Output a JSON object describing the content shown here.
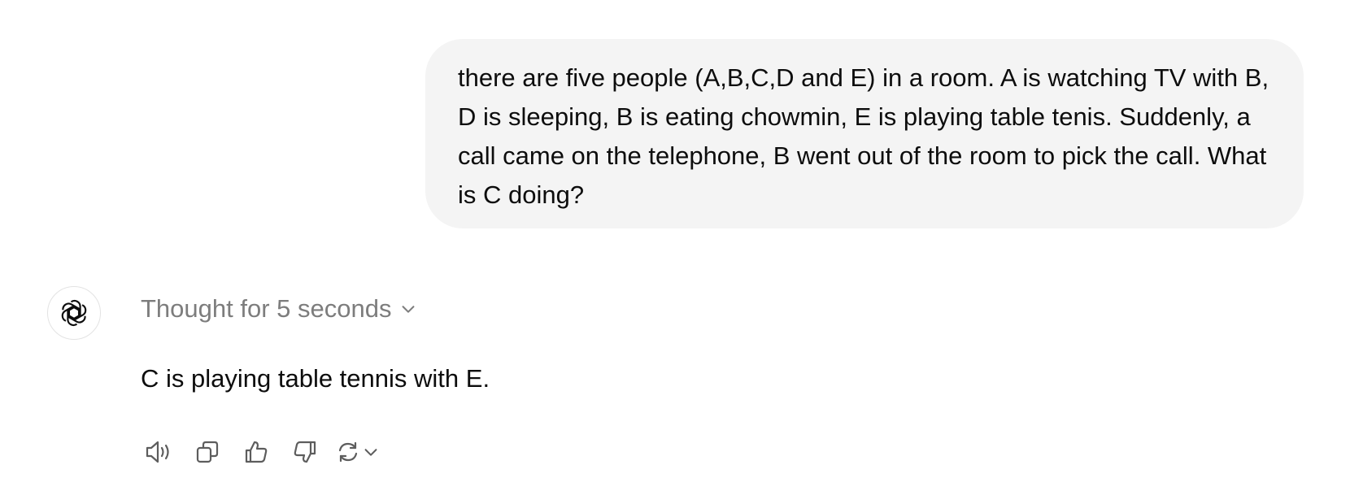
{
  "conversation": {
    "user_message": "there are five people (A,B,C,D and E) in a room. A is watching TV with B, D is sleeping, B is eating chowmin, E is playing table tenis. Suddenly, a call came on the telephone, B went out of the room to pick the call. What is C doing?",
    "assistant": {
      "avatar_icon": "openai-logo-icon",
      "thought_label": "Thought for 5 seconds",
      "answer": "C is playing table tennis with E."
    },
    "actions": [
      {
        "name": "read-aloud-button",
        "icon": "speaker-icon"
      },
      {
        "name": "copy-button",
        "icon": "copy-icon"
      },
      {
        "name": "good-response-button",
        "icon": "thumbs-up-icon"
      },
      {
        "name": "bad-response-button",
        "icon": "thumbs-down-icon"
      },
      {
        "name": "regenerate-button",
        "icon": "refresh-icon"
      }
    ]
  },
  "colors": {
    "bubble_background": "#f4f4f4",
    "text_primary": "#0d0d0d",
    "text_muted": "#7d7d7d"
  }
}
